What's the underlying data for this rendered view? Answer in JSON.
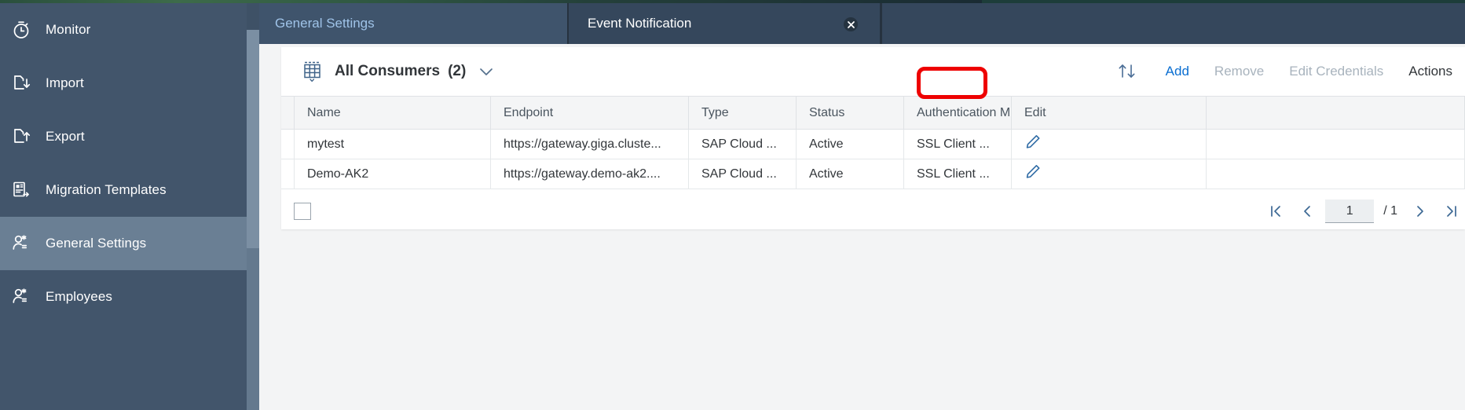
{
  "window": {
    "accent_blue": "#0a6ed1",
    "sidebar_bg": "#42556b",
    "annotation_color": "#ee0000"
  },
  "sidebar": {
    "items": [
      {
        "label": "Monitor",
        "icon": "stopwatch-icon",
        "selected": false
      },
      {
        "label": "Import",
        "icon": "file-download-icon",
        "selected": false
      },
      {
        "label": "Export",
        "icon": "file-upload-icon",
        "selected": false
      },
      {
        "label": "Migration Templates",
        "icon": "template-arrow-icon",
        "selected": false
      },
      {
        "label": "General Settings",
        "icon": "user-star-icon",
        "selected": true
      },
      {
        "label": "Employees",
        "icon": "user-star-icon",
        "selected": false
      }
    ]
  },
  "tabs": [
    {
      "label": "General Settings",
      "active": false,
      "closable": false
    },
    {
      "label": "Event Notification",
      "active": true,
      "closable": true
    }
  ],
  "toolbar": {
    "title": "All Consumers",
    "count": "(2)",
    "sort_icon": "sort-icon",
    "chevron_icon": "chevron-down-icon",
    "table_icon": "table-icon",
    "buttons": [
      {
        "label": "Add",
        "state": "enabled",
        "highlighted": true
      },
      {
        "label": "Remove",
        "state": "disabled",
        "highlighted": false
      },
      {
        "label": "Edit Credentials",
        "state": "disabled",
        "highlighted": false
      },
      {
        "label": "Actions",
        "state": "dark",
        "highlighted": false
      }
    ]
  },
  "table": {
    "columns": [
      "Name",
      "Endpoint",
      "Type",
      "Status",
      "Authentication M",
      "Edit"
    ],
    "rows": [
      {
        "name": "mytest",
        "endpoint": "https://gateway.giga.cluste...",
        "type": "SAP Cloud ...",
        "status": "Active",
        "auth": "SSL Client ...",
        "edit_icon": "pencil-icon"
      },
      {
        "name": "Demo-AK2",
        "endpoint": "https://gateway.demo-ak2....",
        "type": "SAP Cloud ...",
        "status": "Active",
        "auth": "SSL Client ...",
        "edit_icon": "pencil-icon"
      }
    ]
  },
  "pagination": {
    "first_icon": "go-to-first-icon",
    "prev_icon": "go-to-previous-icon",
    "current_page": "1",
    "total_pages": "/ 1",
    "next_icon": "go-to-next-icon",
    "last_icon": "go-to-last-icon"
  }
}
